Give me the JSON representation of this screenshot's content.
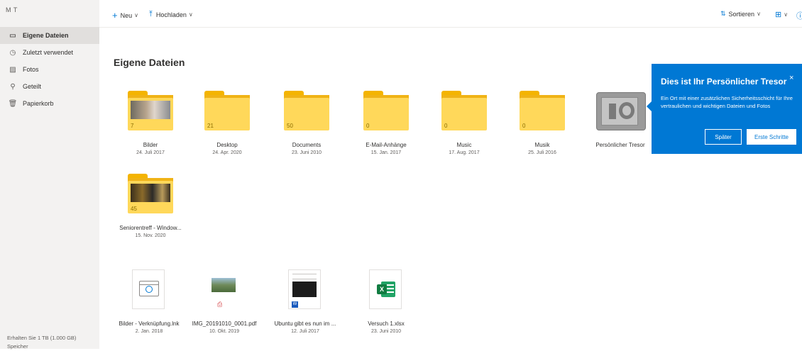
{
  "user": {
    "initials": "M T"
  },
  "sidebar": {
    "items": [
      {
        "label": "Eigene Dateien",
        "icon": "folder-icon"
      },
      {
        "label": "Zuletzt verwendet",
        "icon": "clock-icon"
      },
      {
        "label": "Fotos",
        "icon": "photo-icon"
      },
      {
        "label": "Geteilt",
        "icon": "share-icon"
      },
      {
        "label": "Papierkorb",
        "icon": "trash-icon"
      }
    ],
    "promo": "Erhalten Sie 1 TB (1.000 GB) Speicher"
  },
  "toolbar": {
    "new_label": "Neu",
    "upload_label": "Hochladen",
    "sort_label": "Sortieren"
  },
  "page": {
    "title": "Eigene Dateien"
  },
  "folders": [
    {
      "name": "Bilder",
      "date": "24. Juli 2017",
      "count": "7"
    },
    {
      "name": "Desktop",
      "date": "24. Apr. 2020",
      "count": "21"
    },
    {
      "name": "Documents",
      "date": "23. Juni 2010",
      "count": "50"
    },
    {
      "name": "E-Mail-Anhänge",
      "date": "15. Jan. 2017",
      "count": "0"
    },
    {
      "name": "Music",
      "date": "17. Aug. 2017",
      "count": "0"
    },
    {
      "name": "Musik",
      "date": "25. Juli 2016",
      "count": "0"
    },
    {
      "name": "Persönlicher Tresor",
      "date": ""
    },
    {
      "name": "Seniorentreff - Window...",
      "date": "15. Nov. 2020",
      "count": "45"
    }
  ],
  "files": [
    {
      "name": "Bilder - Verknüpfung.lnk",
      "date": "2. Jan. 2018"
    },
    {
      "name": "IMG_20191010_0001.pdf",
      "date": "10. Okt. 2019"
    },
    {
      "name": "Ubuntu gibt es nun im ...",
      "date": "12. Juli 2017"
    },
    {
      "name": "Versuch 1.xlsx",
      "date": "23. Juni 2010"
    }
  ],
  "callout": {
    "title": "Dies ist Ihr Persönlicher Tresor",
    "body": "Ein Ort mit einer zusätzlichen Sicherheitsschicht für Ihre vertraulichen und wichtigen Dateien und Fotos",
    "later": "Später",
    "start": "Erste Schritte",
    "close": "×"
  },
  "colors": {
    "accent": "#0078d4",
    "folder": "#ffd85a",
    "sidebar": "#f3f2f1"
  }
}
